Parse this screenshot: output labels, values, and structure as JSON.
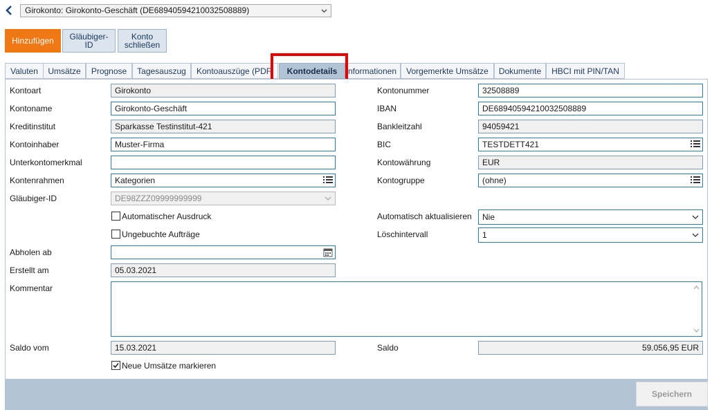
{
  "header": {
    "account_selector": "Girokonto: Girokonto-Geschäft (DE68940594210032508889)"
  },
  "actions": {
    "add": "Hinzufügen",
    "creditor_id": "Gläubiger-\nID",
    "close_account": "Konto\nschließen"
  },
  "tabs": [
    {
      "label": "Valuten"
    },
    {
      "label": "Umsätze"
    },
    {
      "label": "Prognose"
    },
    {
      "label": "Tagesauszug"
    },
    {
      "label": "Kontoauszüge (PDF"
    },
    {
      "label": "Kontodetails"
    },
    {
      "label": "Informationen"
    },
    {
      "label": "Vorgemerkte Umsätze"
    },
    {
      "label": "Dokumente"
    },
    {
      "label": "HBCI mit PIN/TAN"
    }
  ],
  "form": {
    "kontoart": {
      "label": "Kontoart",
      "value": "Girokonto"
    },
    "kontoname": {
      "label": "Kontoname",
      "value": "Girokonto-Geschäft"
    },
    "kreditinstitut": {
      "label": "Kreditinstitut",
      "value": "Sparkasse Testinstitut-421"
    },
    "kontoinhaber": {
      "label": "Kontoinhaber",
      "value": "Muster-Firma"
    },
    "unterkontomerkmal": {
      "label": "Unterkontomerkmal",
      "value": ""
    },
    "kontenrahmen": {
      "label": "Kontenrahmen",
      "value": "Kategorien"
    },
    "glaeubiger_id": {
      "label": "Gläubiger-ID",
      "value": "DE98ZZZ09999999999"
    },
    "auto_print": {
      "label": "Automatischer Ausdruck",
      "checked": false
    },
    "unbooked": {
      "label": "Ungebuchte Aufträge",
      "checked": false
    },
    "abholen_ab": {
      "label": "Abholen ab",
      "value": ""
    },
    "erstellt_am": {
      "label": "Erstellt am",
      "value": "05.03.2021"
    },
    "kommentar": {
      "label": "Kommentar",
      "value": ""
    },
    "saldo_vom": {
      "label": "Saldo vom",
      "value": "15.03.2021"
    },
    "mark_new": {
      "label": "Neue Umsätze markieren",
      "checked": true
    },
    "kontonummer": {
      "label": "Kontonummer",
      "value": "32508889"
    },
    "iban": {
      "label": "IBAN",
      "value": "DE68940594210032508889"
    },
    "bankleitzahl": {
      "label": "Bankleitzahl",
      "value": "94059421"
    },
    "bic": {
      "label": "BIC",
      "value": "TESTDETT421"
    },
    "kontowaehrung": {
      "label": "Kontowährung",
      "value": "EUR"
    },
    "kontogruppe": {
      "label": "Kontogruppe",
      "value": "(ohne)"
    },
    "auto_update": {
      "label": "Automatisch aktualisieren",
      "value": "Nie"
    },
    "loeschintervall": {
      "label": "Löschintervall",
      "value": "1"
    },
    "saldo": {
      "label": "Saldo",
      "value": "59.056,95 EUR"
    }
  },
  "footer": {
    "save": "Speichern"
  }
}
